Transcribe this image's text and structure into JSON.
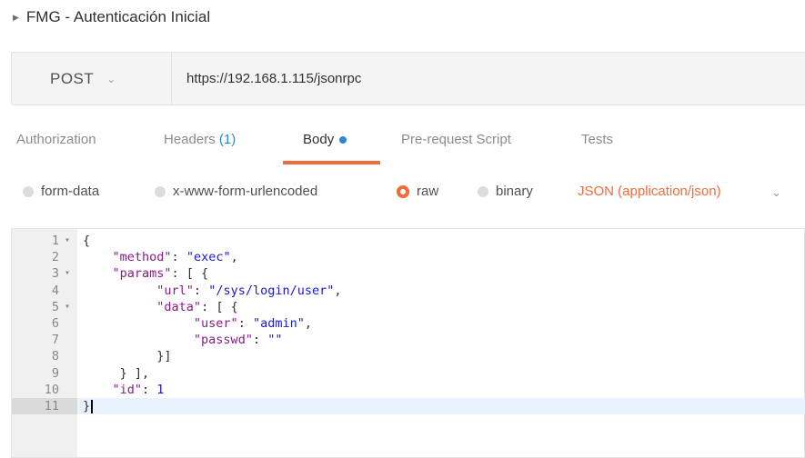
{
  "request": {
    "title": "FMG - Autenticación Inicial",
    "method": "POST",
    "url": "https://192.168.1.115/jsonrpc"
  },
  "tabs": [
    {
      "label": "Authorization"
    },
    {
      "label": "Headers",
      "count": "(1)"
    },
    {
      "label": "Body"
    },
    {
      "label": "Pre-request Script"
    },
    {
      "label": "Tests"
    }
  ],
  "body_options": {
    "form_data": "form-data",
    "urlencoded": "x-www-form-urlencoded",
    "raw": "raw",
    "binary": "binary",
    "selected": "raw",
    "content_type": "JSON (application/json)"
  },
  "editor": {
    "current_line": 11,
    "lines": [
      {
        "num": "1",
        "fold": true
      },
      {
        "num": "2",
        "key": "\"method\"",
        "value": "\"exec\""
      },
      {
        "num": "3",
        "fold": true,
        "key": "\"params\""
      },
      {
        "num": "4",
        "key": "\"url\"",
        "value": "\"/sys/login/user\""
      },
      {
        "num": "5",
        "fold": true,
        "key": "\"data\""
      },
      {
        "num": "6",
        "key": "\"user\"",
        "value": "\"admin\""
      },
      {
        "num": "7",
        "key": "\"passwd\"",
        "value": "\"\""
      },
      {
        "num": "8",
        "text": "}]"
      },
      {
        "num": "9",
        "text": "} ],"
      },
      {
        "num": "10",
        "key": "\"id\"",
        "value": "1"
      },
      {
        "num": "11",
        "text": "}"
      }
    ]
  },
  "colors": {
    "accent": "#f26b3a",
    "link_blue": "#2a86d8",
    "json_key": "#8a1a8a",
    "json_string": "#1a1ad0"
  }
}
